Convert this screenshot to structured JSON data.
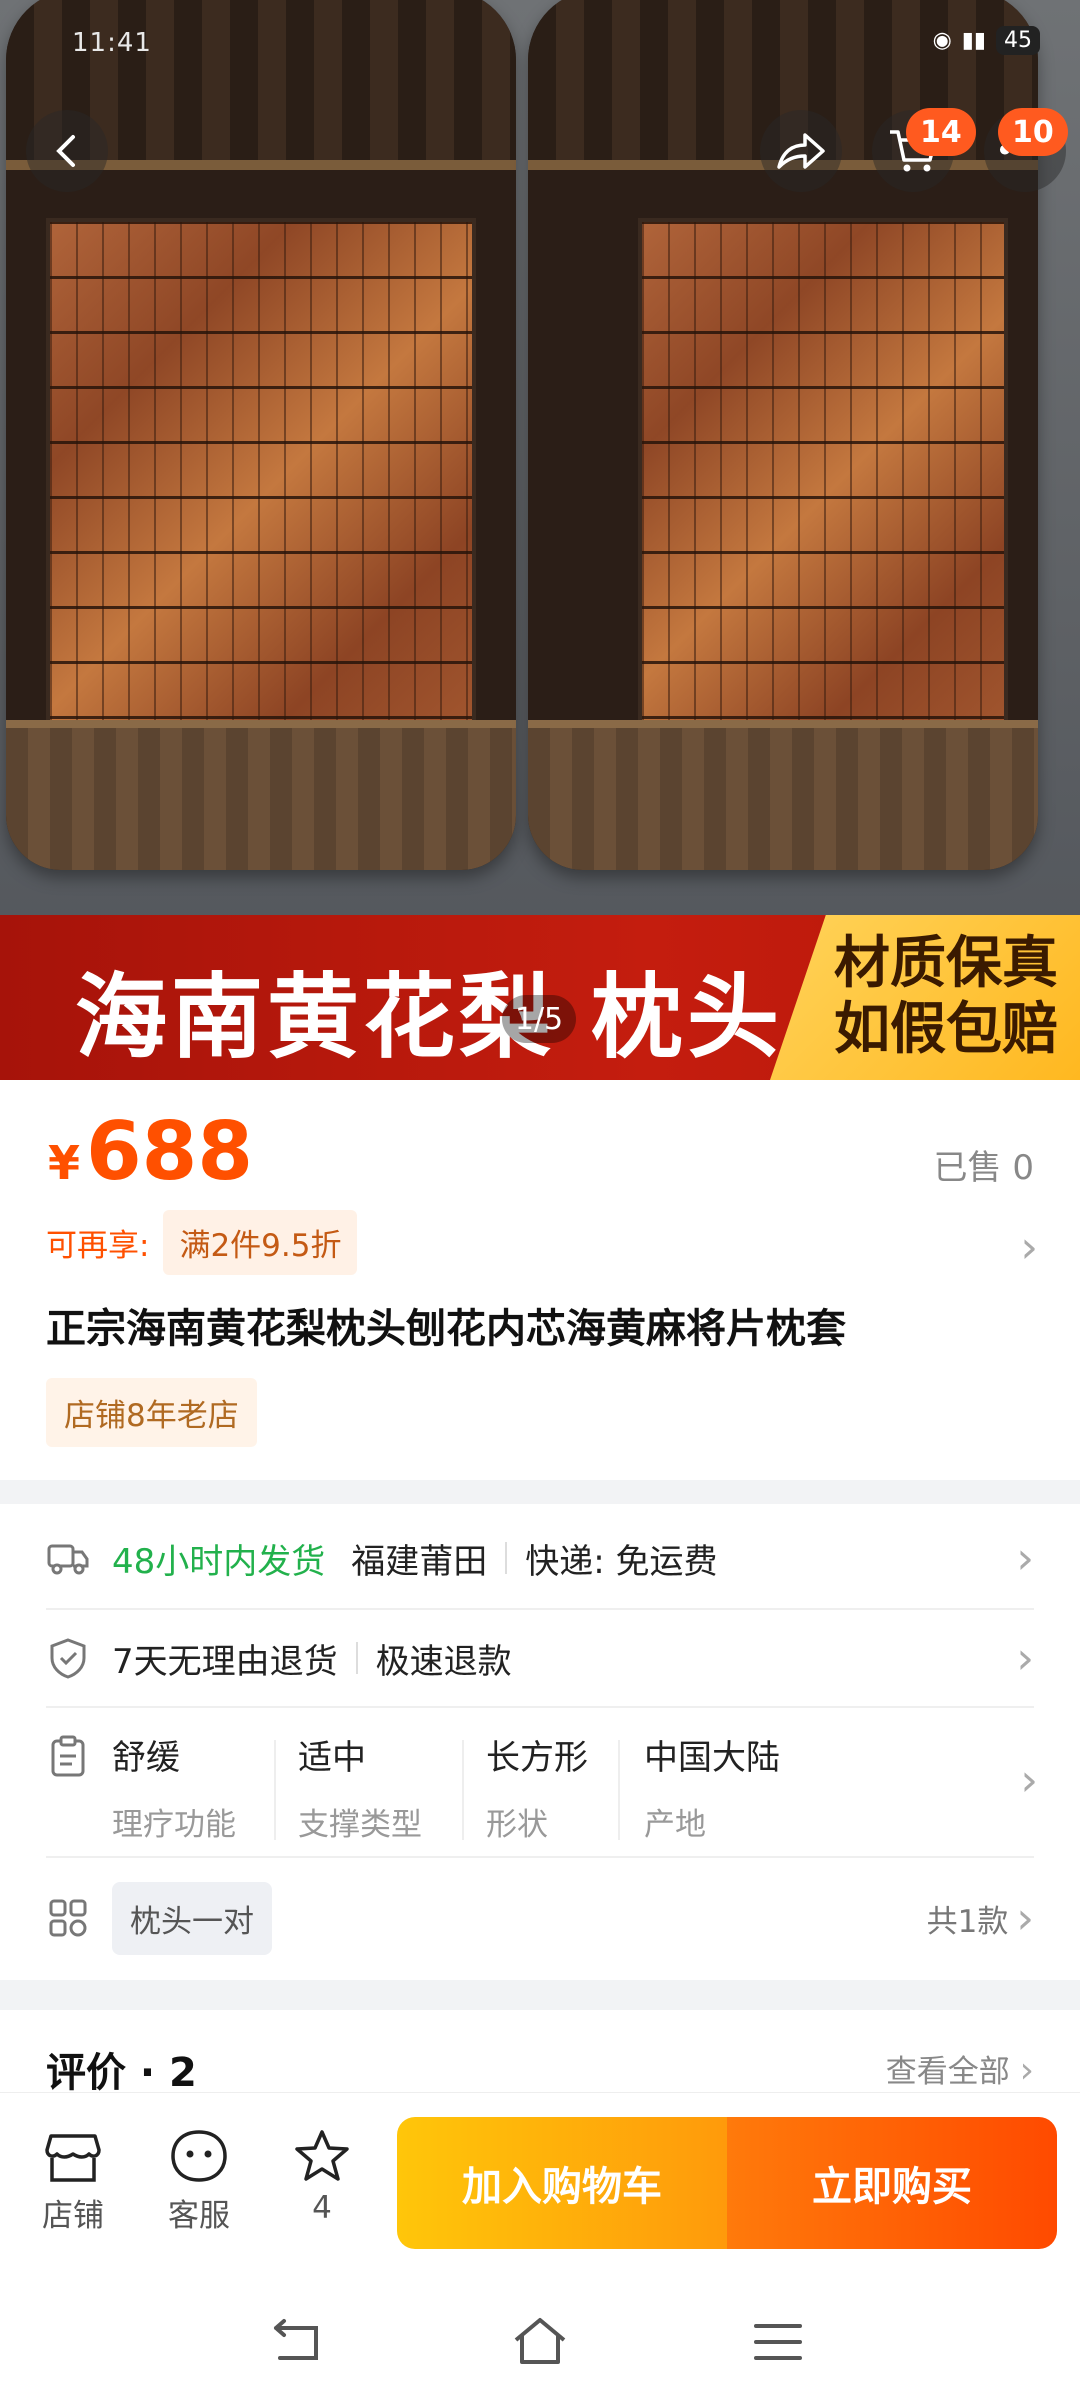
{
  "status_bar": {
    "time": "11:41",
    "battery": "45"
  },
  "header": {
    "cart_count": "14",
    "more_count": "10"
  },
  "banner": {
    "title": "海南黄花梨 枕头",
    "badge_line1": "材质保真",
    "badge_line2": "如假包赔",
    "pager": "1/5"
  },
  "price": {
    "currency": "¥",
    "value": "688",
    "sold": "已售 0"
  },
  "promo": {
    "label": "可再享:",
    "tag": "满2件9.5折"
  },
  "product": {
    "title": "正宗海南黄花梨枕头刨花内芯海黄麻将片枕套",
    "shop_tag": "店铺8年老店"
  },
  "shipping": {
    "dispatch": "48小时内发货",
    "origin": "福建莆田",
    "delivery": "快递: 免运费"
  },
  "service": {
    "returns": "7天无理由退货",
    "refund": "极速退款"
  },
  "specs": [
    {
      "value": "舒缓",
      "key": "理疗功能"
    },
    {
      "value": "适中",
      "key": "支撑类型"
    },
    {
      "value": "长方形",
      "key": "形状"
    },
    {
      "value": "中国大陆",
      "key": "产地"
    }
  ],
  "sku": {
    "option": "枕头一对",
    "count": "共1款"
  },
  "reviews": {
    "title": "评价 · 2",
    "view_all": "查看全部"
  },
  "bottom_bar": {
    "shop": "店铺",
    "service": "客服",
    "fav_count": "4",
    "add_cart": "加入购物车",
    "buy_now": "立即购买"
  },
  "colors": {
    "accent": "#ff5000",
    "green": "#22b14c",
    "banner_red": "#c41d0e"
  }
}
